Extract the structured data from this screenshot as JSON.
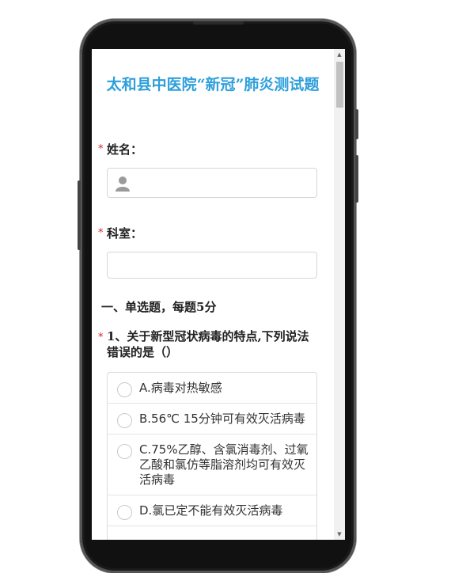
{
  "form": {
    "title": "太和县中医院“新冠”肺炎测试题",
    "required_mark": "*",
    "name_label": "姓名：",
    "name_value": "",
    "dept_label": "科室：",
    "dept_value": "",
    "section_heading": "一、单选题，每题5分",
    "question1": {
      "text": "1、关于新型冠状病毒的特点,下列说法错误的是（）",
      "options": [
        "A.病毒对热敏感",
        "B.56℃ 15分钟可有效灭活病毒",
        "C.75%乙醇、含氯消毒剂、过氧乙酸和氯仿等脂溶剂均可有效灭活病毒",
        "D.氯已定不能有效灭活病毒"
      ]
    }
  },
  "icons": {
    "name_field": "user-icon",
    "scroll_up": "arrow-up-icon",
    "scroll_down": "arrow-down-icon"
  }
}
